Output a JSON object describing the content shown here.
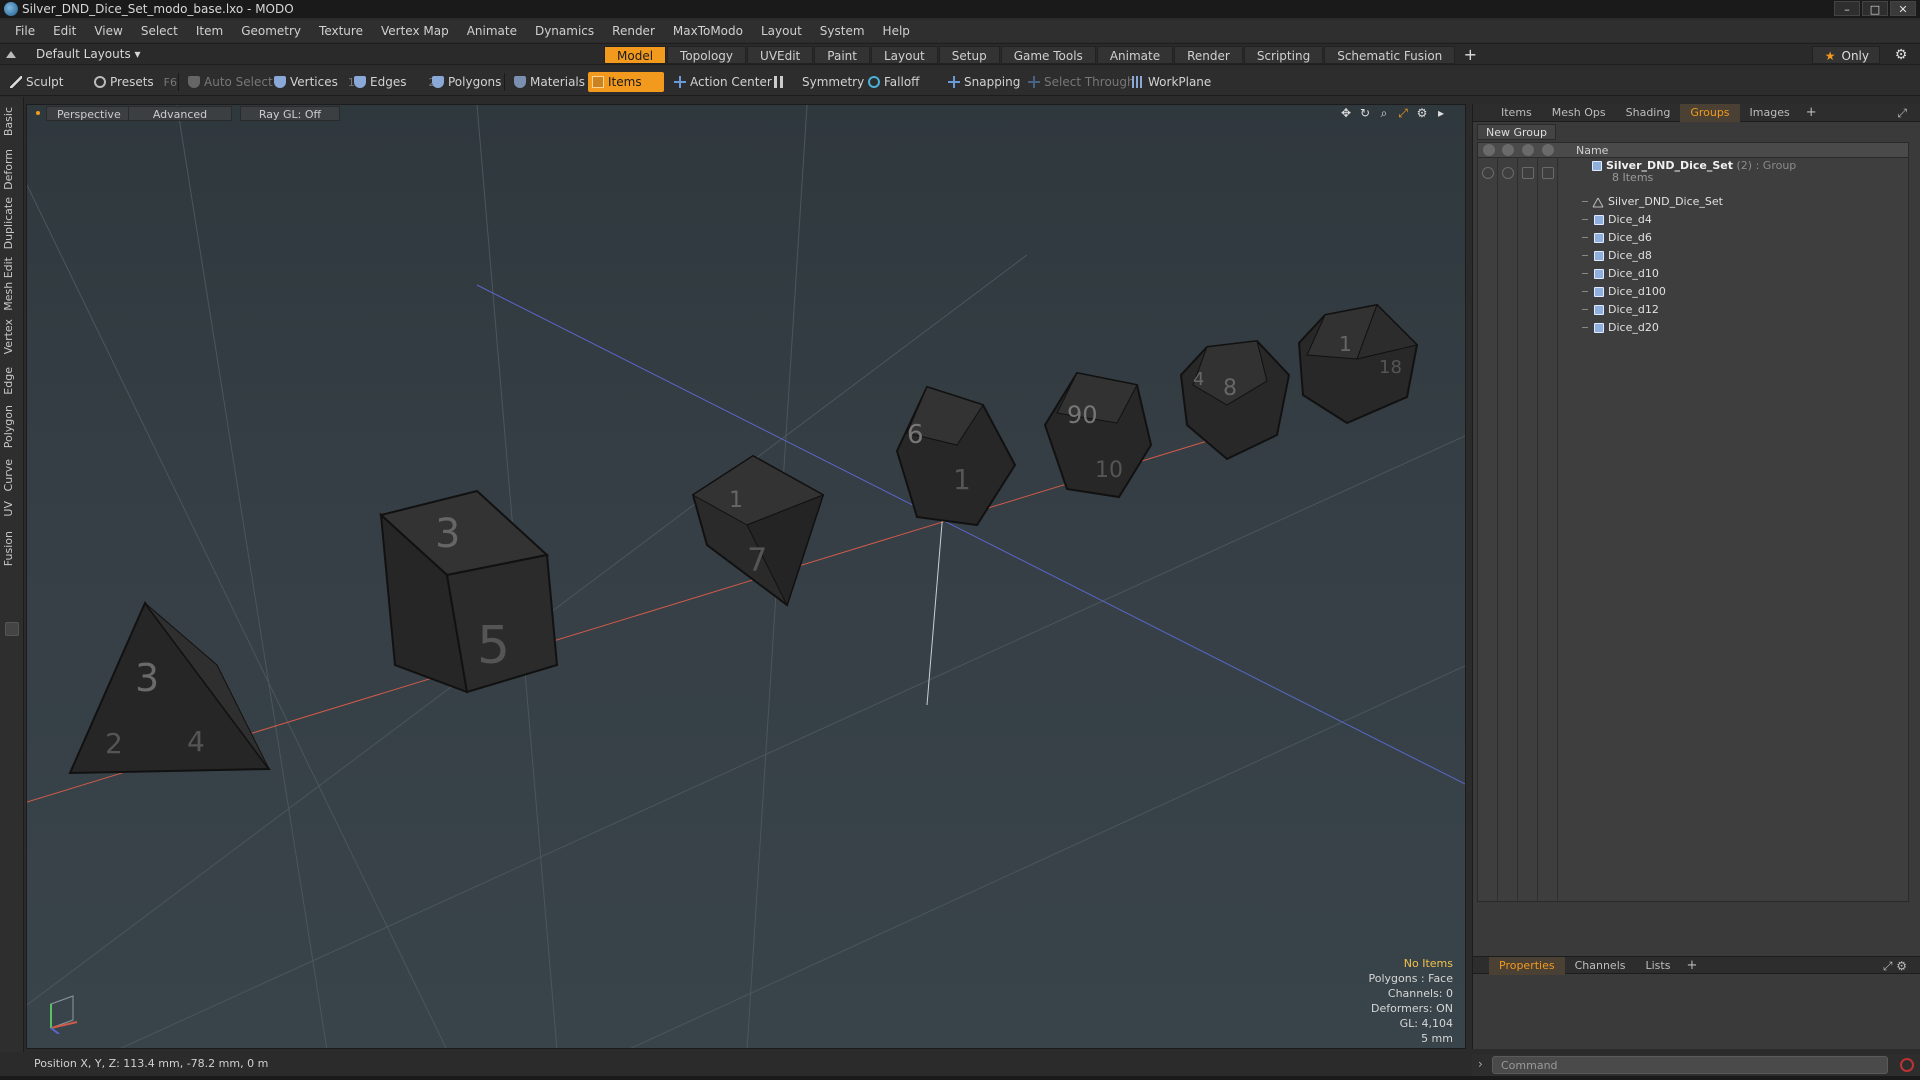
{
  "window": {
    "title": "Silver_DND_Dice_Set_modo_base.lxo - MODO",
    "controls": [
      "–",
      "□",
      "✕"
    ]
  },
  "menu": [
    "File",
    "Edit",
    "View",
    "Select",
    "Item",
    "Geometry",
    "Texture",
    "Vertex Map",
    "Animate",
    "Dynamics",
    "Render",
    "MaxToModo",
    "Layout",
    "System",
    "Help"
  ],
  "layout_selector": "Default Layouts ▾",
  "mode_tabs": [
    {
      "label": "Model",
      "active": true
    },
    {
      "label": "Topology",
      "active": false
    },
    {
      "label": "UVEdit",
      "active": false
    },
    {
      "label": "Paint",
      "active": false
    },
    {
      "label": "Layout",
      "active": false
    },
    {
      "label": "Setup",
      "active": false
    },
    {
      "label": "Game Tools",
      "active": false
    },
    {
      "label": "Animate",
      "active": false
    },
    {
      "label": "Render",
      "active": false
    },
    {
      "label": "Scripting",
      "active": false
    },
    {
      "label": "Schematic Fusion",
      "active": false
    }
  ],
  "only_label": "Only",
  "toolbar": {
    "sculpt": "Sculpt",
    "presets": "Presets",
    "presets_key": "F6",
    "auto_select": "Auto Select",
    "vertices": "Vertices",
    "vertices_key": "1",
    "edges": "Edges",
    "edges_key": "2",
    "polygons": "Polygons",
    "materials": "Materials",
    "items": "Items",
    "action_center": "Action Center",
    "symmetry": "Symmetry",
    "falloff": "Falloff",
    "snapping": "Snapping",
    "select_through": "Select Through",
    "workplane": "WorkPlane"
  },
  "left_palette": [
    "Basic",
    "Deform",
    "Duplicate",
    "Mesh Edit",
    "Vertex",
    "Edge",
    "Polygon",
    "Curve",
    "UV",
    "Fusion"
  ],
  "viewport": {
    "view": "Perspective",
    "shading": "Advanced",
    "raygl": "Ray GL: Off",
    "hud": {
      "selection": "No Items",
      "polygons": "Polygons : Face",
      "channels": "Channels: 0",
      "deformers": "Deformers: ON",
      "gl": "GL: 4,104",
      "scale": "5 mm"
    },
    "dice_numbers": {
      "d4": [
        "3",
        "2",
        "4"
      ],
      "d6": [
        "3",
        "5"
      ],
      "d8": [
        "7",
        "1"
      ],
      "d10": [
        "6",
        "1"
      ],
      "d100": [
        "90",
        "10"
      ],
      "d12": [
        "8",
        "4"
      ],
      "d20": [
        "1",
        "18"
      ]
    }
  },
  "status": {
    "position": "Position X, Y, Z:   113.4 mm, -78.2 mm, 0 m"
  },
  "right_panel": {
    "tabs": [
      {
        "label": "Items",
        "active": false
      },
      {
        "label": "Mesh Ops",
        "active": false
      },
      {
        "label": "Shading",
        "active": false
      },
      {
        "label": "Groups",
        "active": true
      },
      {
        "label": "Images",
        "active": false
      }
    ],
    "new_group": "New Group",
    "name_column": "Name",
    "group": {
      "name": "Silver_DND_Dice_Set",
      "meta": " (2) : Group",
      "count": "8 Items"
    },
    "items": [
      {
        "label": "Silver_DND_Dice_Set",
        "kind": "locator"
      },
      {
        "label": "Dice_d4",
        "kind": "mesh"
      },
      {
        "label": "Dice_d6",
        "kind": "mesh"
      },
      {
        "label": "Dice_d8",
        "kind": "mesh"
      },
      {
        "label": "Dice_d10",
        "kind": "mesh"
      },
      {
        "label": "Dice_d100",
        "kind": "mesh"
      },
      {
        "label": "Dice_d12",
        "kind": "mesh"
      },
      {
        "label": "Dice_d20",
        "kind": "mesh"
      }
    ],
    "bottom_tabs": [
      {
        "label": "Properties",
        "active": true
      },
      {
        "label": "Channels",
        "active": false
      },
      {
        "label": "Lists",
        "active": false
      }
    ],
    "command_placeholder": "Command"
  },
  "colors": {
    "accent": "#f29a1e",
    "viewport_bg": "#353f45",
    "panel_bg": "#3a3a3a",
    "x_axis": "#d05a4a",
    "z_axis": "#5a66c8"
  }
}
